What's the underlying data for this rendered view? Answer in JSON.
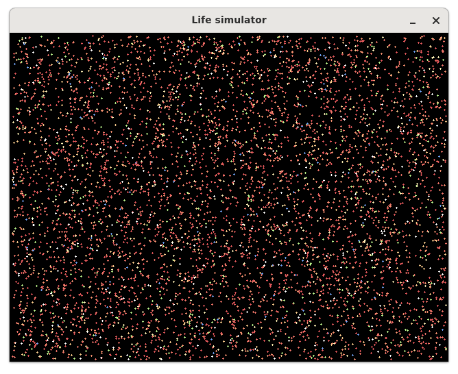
{
  "window": {
    "title": "Life simulator",
    "buttons": [
      {
        "name": "minimize",
        "icon": "minimize-icon"
      },
      {
        "name": "close",
        "icon": "close-icon"
      }
    ]
  },
  "simulation": {
    "background": "#000000",
    "particle_colors": [
      "#e0575a",
      "#ee7468",
      "#f28f6e",
      "#f6c98a",
      "#fbeeb4",
      "#ffffff",
      "#b8f08a",
      "#6fa0f0"
    ],
    "particle_shape": "plus-cross",
    "particle_count_estimate": 6000
  }
}
